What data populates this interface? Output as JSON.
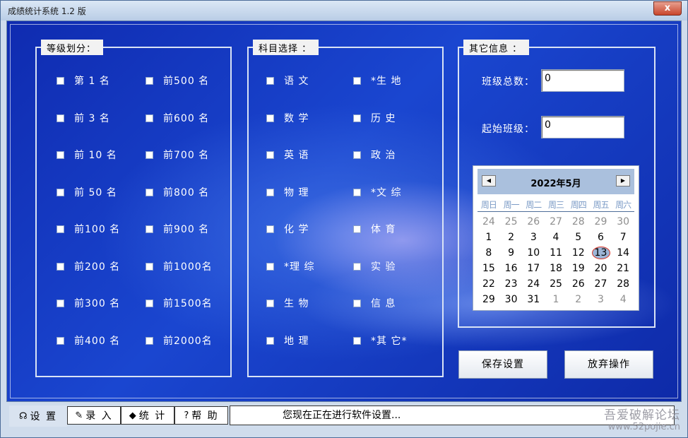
{
  "window": {
    "title": "成绩统计系统 1.2 版",
    "close": "x"
  },
  "rank_group": {
    "title": "等级划分：",
    "col1": [
      "第 1 名",
      "前 3 名",
      "前 10 名",
      "前 50 名",
      "前100 名",
      "前200 名",
      "前300 名",
      "前400 名"
    ],
    "col2": [
      "前500 名",
      "前600 名",
      "前700 名",
      "前800 名",
      "前900 名",
      "前1000名",
      "前1500名",
      "前2000名"
    ]
  },
  "subject_group": {
    "title": "科目选择 ：",
    "col1": [
      "语 文",
      "数 学",
      "英 语",
      "物 理",
      "化 学",
      "*理 综",
      "生 物",
      "地 理"
    ],
    "col2": [
      "*生 地",
      "历 史",
      "政 治",
      "*文 综",
      "体 育",
      "实 验",
      "信 息",
      "*其 它*"
    ]
  },
  "other_group": {
    "title": "其它信息 ：",
    "class_total_label": "班级总数：",
    "class_total_value": "0",
    "start_class_label": "起始班级：",
    "start_class_value": "0"
  },
  "calendar": {
    "month": "2022年5月",
    "prev": "◀",
    "next": "▶",
    "weekdays": [
      "周日",
      "周一",
      "周二",
      "周三",
      "周四",
      "周五",
      "周六"
    ],
    "weeks": [
      [
        "24",
        "25",
        "26",
        "27",
        "28",
        "29",
        "30"
      ],
      [
        "1",
        "2",
        "3",
        "4",
        "5",
        "6",
        "7"
      ],
      [
        "8",
        "9",
        "10",
        "11",
        "12",
        "13",
        "14"
      ],
      [
        "15",
        "16",
        "17",
        "18",
        "19",
        "20",
        "21"
      ],
      [
        "22",
        "23",
        "24",
        "25",
        "26",
        "27",
        "28"
      ],
      [
        "29",
        "30",
        "31",
        "1",
        "2",
        "3",
        "4"
      ]
    ],
    "selected": "13"
  },
  "buttons": {
    "save": "保存设置",
    "cancel": "放弃操作"
  },
  "tabs": [
    {
      "icon": "☊",
      "label": "设 置"
    },
    {
      "icon": "✎",
      "label": "录 入"
    },
    {
      "icon": "◆",
      "label": "统 计"
    },
    {
      "icon": "?",
      "label": "帮 助"
    }
  ],
  "status": "您现在正在进行软件设置...",
  "watermark": {
    "line1": "吾爱破解论坛",
    "line2": "www.52pojie.cn"
  }
}
